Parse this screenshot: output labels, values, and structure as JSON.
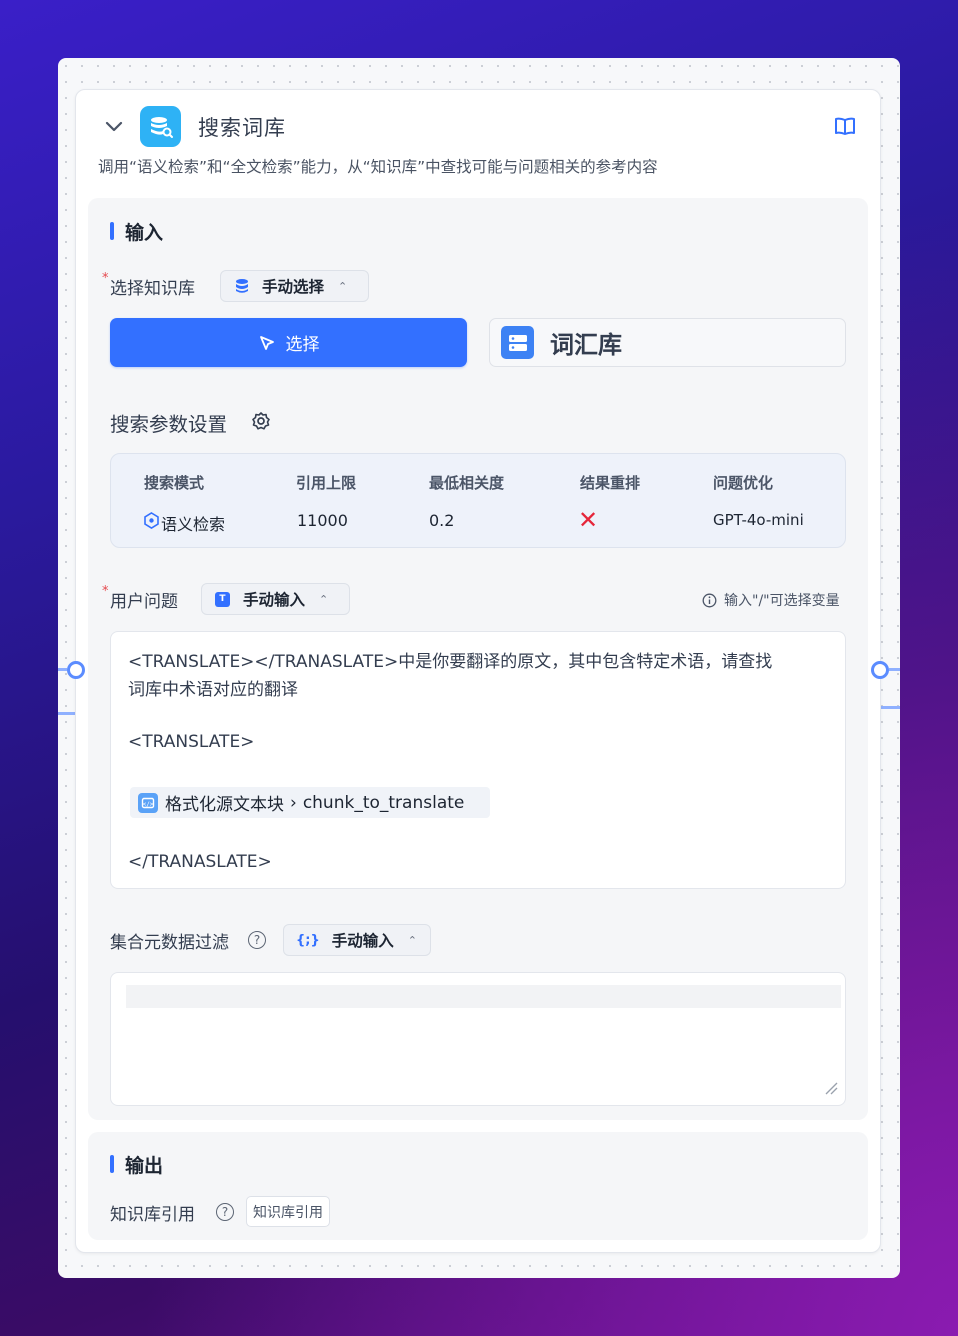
{
  "node": {
    "title": "搜索词库",
    "description": "调用“语义检索”和“全文检索”能力，从“知识库”中查找可能与问题相关的参考内容"
  },
  "input_section": {
    "title": "输入",
    "kb_select": {
      "required_mark": "*",
      "label": "选择知识库",
      "mode": "手动选择",
      "select_button": "选择",
      "selected_kb": "词汇库"
    },
    "search_params": {
      "title": "搜索参数设置",
      "headers": [
        "搜索模式",
        "引用上限",
        "最低相关度",
        "结果重排",
        "问题优化"
      ],
      "values": {
        "mode": "语义检索",
        "limit": "11000",
        "min_similarity": "0.2",
        "rerank": "✕",
        "query_opt": "GPT-4o-mini"
      }
    },
    "user_question": {
      "required_mark": "*",
      "label": "用户问题",
      "mode": "手动输入",
      "hint": "输入\"/\"可选择变量",
      "lines": [
        "<TRANSLATE></TRANASLATE>中是你要翻译的原文，其中包含特定术语，请查找",
        "词库中术语对应的翻译",
        "<TRANSLATE>",
        "</TRANASLATE>"
      ],
      "variable": {
        "source": "格式化源文本块",
        "separator": "›",
        "name": "chunk_to_translate"
      }
    },
    "metadata_filter": {
      "label": "集合元数据过滤",
      "help": "?",
      "mode": "手动输入"
    }
  },
  "output_section": {
    "title": "输出",
    "kb_quote": {
      "label": "知识库引用",
      "help": "?",
      "tag": "知识库引用"
    }
  },
  "colors": {
    "primary": "#3370ff",
    "app_icon": "#2eb2f5",
    "danger": "#e5484d"
  }
}
